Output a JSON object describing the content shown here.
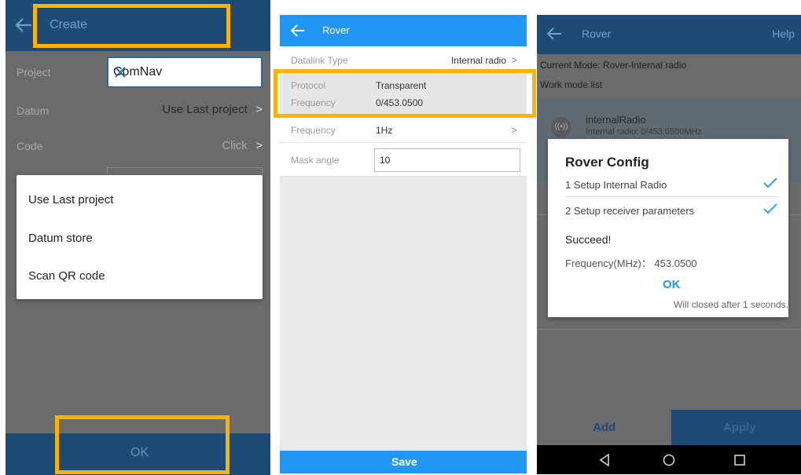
{
  "screen1": {
    "title": "Create",
    "project_label": "Project",
    "project_value": "ComNav",
    "datum_label": "Datum",
    "datum_value": "Use Last project",
    "code_label": "Code",
    "code_value": "Click",
    "popup_items": [
      "Use Last project",
      "Datum store",
      "Scan QR code"
    ],
    "ok_label": "OK"
  },
  "screen2": {
    "title": "Rover",
    "datalink_label": "Datalink Type",
    "datalink_value": "Internal radio",
    "protocol_label": "Protocol",
    "protocol_value": "Transparent",
    "frequency_label": "Frequency",
    "frequency_value": "0/453.0500",
    "rate_label": "Frequency",
    "rate_value": "1Hz",
    "mask_label": "Mask angle",
    "mask_value": "10",
    "save_label": "Save"
  },
  "screen3": {
    "title": "Rover",
    "help_label": "Help",
    "current_mode": "Current Mode:  Rover-Internal radio",
    "work_mode_list": "Work mode list",
    "item_title": "internalRadio",
    "item_sub": "Internal radio: 0/453.0500MHz",
    "dialog_title": "Rover Config",
    "step1": "1  Setup Internal Radio",
    "step2": "2  Setup receiver parameters",
    "succeed": "Succeed!",
    "frequency_line": "Frequency(MHz)： 453.0500",
    "ok_label": "OK",
    "closed_msg": "Will closed after 1 seconds.",
    "add_label": "Add",
    "apply_label": "Apply"
  },
  "colors": {
    "dark_appbar": "#1d4b75",
    "blue_appbar": "#2196f3",
    "highlight": "#ffb300",
    "dim_overlay": "#6b6b6b"
  }
}
